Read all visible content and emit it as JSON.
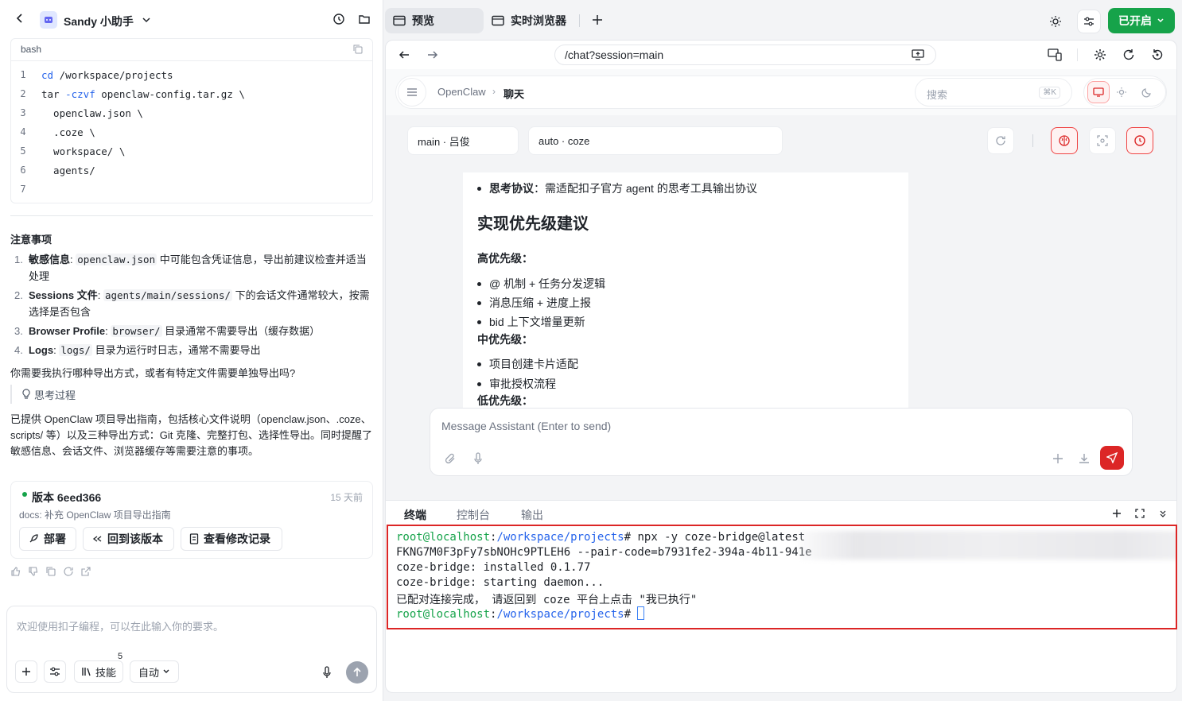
{
  "left": {
    "app_title": "Sandy 小助手",
    "code": {
      "lang": "bash",
      "lines": [
        {
          "n": "1",
          "cmd": "cd",
          "rest": " /workspace/projects"
        },
        {
          "n": "2",
          "pre": "tar ",
          "flag": "-czvf",
          "rest": " openclaw-config.tar.gz \\"
        },
        {
          "n": "3",
          "rest": "  openclaw.json \\"
        },
        {
          "n": "4",
          "rest": "  .coze \\"
        },
        {
          "n": "5",
          "rest": "  workspace/ \\"
        },
        {
          "n": "6",
          "rest": "  agents/"
        },
        {
          "n": "7",
          "rest": ""
        }
      ]
    },
    "notes_title": "注意事项",
    "notes": [
      {
        "num": "1.",
        "label": "敏感信息",
        "sep": ":",
        "code": "openclaw.json",
        "text": " 中可能包含凭证信息，导出前建议检查并适当处理"
      },
      {
        "num": "2.",
        "label": "Sessions 文件",
        "sep": ":",
        "code": "agents/main/sessions/",
        "text": " 下的会话文件通常较大，按需选择是否包含"
      },
      {
        "num": "3.",
        "label": "Browser Profile",
        "sep": ":",
        "code": "browser/",
        "text": " 目录通常不需要导出（缓存数据）"
      },
      {
        "num": "4.",
        "label": "Logs",
        "sep": ":",
        "code": "logs/",
        "text": " 目录为运行时日志，通常不需要导出"
      }
    ],
    "question": "你需要我执行哪种导出方式，或者有特定文件需要单独导出吗?",
    "thinking_label": "思考过程",
    "summary": "已提供 OpenClaw 项目导出指南，包括核心文件说明（openclaw.json、.coze、scripts/ 等）以及三种导出方式：Git 克隆、完整打包、选择性导出。同时提醒了敏感信息、会话文件、浏览器缓存等需要注意的事项。",
    "version": {
      "title": "版本 6eed366",
      "time": "15 天前",
      "desc": "docs: 补充 OpenClaw 项目导出指南",
      "deploy": "部署",
      "rollback": "回到该版本",
      "history": "查看修改记录"
    },
    "input_placeholder": "欢迎使用扣子编程，可以在此输入你的要求。",
    "skills_label": "技能",
    "skills_count": "5",
    "mode": "自动"
  },
  "topbar": {
    "tab_preview": "预览",
    "tab_browser": "实时浏览器",
    "enabled_button": "已开启"
  },
  "browser": {
    "url": "/chat?session=main",
    "breadcrumb_root": "OpenClaw",
    "breadcrumb_current": "聊天",
    "search_placeholder": "搜索",
    "search_shortcut": "⌘K",
    "session_select": "main · 吕俊",
    "model_select": "auto · coze",
    "message": {
      "bullet_top": "思考协议",
      "bullet_top_text": "：需适配扣子官方 agent 的思考工具输出协议",
      "heading": "实现优先级建议",
      "high": "高优先级：",
      "high_items": [
        "@ 机制 + 任务分发逻辑",
        "消息压缩 + 进度上报",
        "bid 上下文增量更新"
      ],
      "mid": "中优先级：",
      "mid_items": [
        "项目创建卡片适配",
        "审批授权流程"
      ],
      "low": "低优先级："
    },
    "composer_placeholder": "Message Assistant (Enter to send)"
  },
  "terminal": {
    "tabs": [
      "终端",
      "控制台",
      "输出"
    ],
    "prompt_user": "root@localhost",
    "prompt_path": "/workspace/projects",
    "line1_cmd": "# npx -y coze-bridge@latest",
    "line2": "FKNG7M0F3pFy7sbNOHc9PTLEH6 --pair-code=b7931fe2-394a-4b11-941e",
    "line3": "coze-bridge: installed 0.1.77",
    "line4": "coze-bridge: starting daemon...",
    "line5": "已配对连接完成， 请返回到 coze 平台上点击 \"我已执行\"",
    "line6_suffix": "#"
  },
  "colors": {
    "accent_green": "#16a34a",
    "danger_red": "#dc2626",
    "link_blue": "#2563eb"
  }
}
